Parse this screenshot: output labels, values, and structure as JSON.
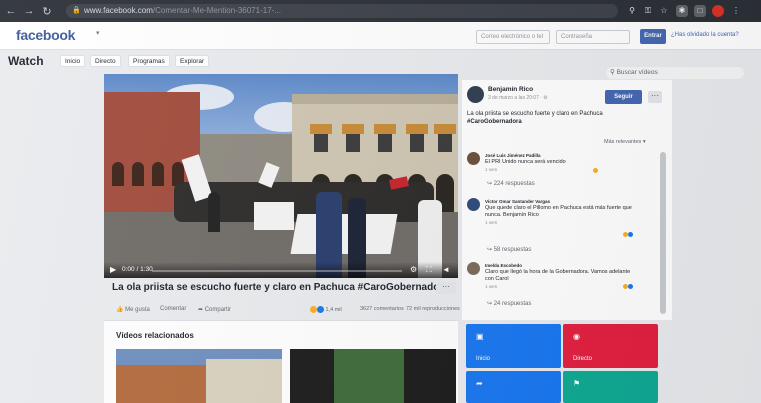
{
  "browser": {
    "url_domain": "www.facebook.com",
    "url_path": "/Comentar-Me-Mention-36071-17-...",
    "back_icon": "arrow-left-icon",
    "forward_icon": "arrow-right-icon",
    "reload_icon": "reload-icon"
  },
  "header": {
    "logo": "facebook",
    "email_placeholder": "Correo electrónico o tel",
    "password_placeholder": "Contraseña",
    "login_label": "Entrar",
    "forgot_label": "¿Has olvidado la cuenta?"
  },
  "watch": {
    "title": "Watch",
    "tabs": [
      "Inicio",
      "Directo",
      "Programas",
      "Explorar"
    ],
    "search_placeholder": "Buscar vídeos"
  },
  "video": {
    "time": "0:00 / 1:30",
    "title": "La ola priista se escucho fuerte y claro en Pachuca #CaroGobernadora",
    "more": "···",
    "actions": {
      "like": "Me gusta",
      "comment": "Comentar",
      "share": "Compartir"
    },
    "stats": {
      "reactions": "1,4 mil",
      "comments": "3627 comentarios",
      "views": "72 mil reproducciones"
    }
  },
  "related": {
    "title": "Vídeos relacionados"
  },
  "post": {
    "author": "Benjamín Rico",
    "meta": "3 de marzo a las 20:07 · ⚙",
    "follow_label": "Seguir",
    "more": "···",
    "text": "La ola priista se escucho fuerte y claro en Pachuca",
    "hashtag": "#CaroGobernadora",
    "sort_label": "Más relevantes ▾"
  },
  "comments": [
    {
      "name": "José Luis Jiménez Padilla",
      "text": "El PRI Unido nunca será vencido",
      "time": "1 sem",
      "reactions": "",
      "replies": "↪ 224 respuestas"
    },
    {
      "name": "Víctor Omar Santander Vargas",
      "text": "Que quede claro el Pillomo en Pachuca está más fuerte que nunca. Benjamín Rico",
      "time": "1 sem",
      "reactions": "",
      "replies": "↪ 58 respuestas"
    },
    {
      "name": "Imelda Escobedo",
      "text": "Claro que llegó la hora de la Gobernadora. Vamos adelante con Carol",
      "time": "1 sem",
      "reactions": "",
      "replies": "↪ 24 respuestas"
    }
  ],
  "tiles": [
    {
      "label": "Inicio",
      "icon": "tv-icon",
      "color": "#1877f2"
    },
    {
      "label": "Directo",
      "icon": "live-icon",
      "color": "#e41e3f"
    },
    {
      "label": "",
      "icon": "share-icon",
      "color": "#1877f2"
    },
    {
      "label": "",
      "icon": "bookmark-icon",
      "color": "#0ea993"
    }
  ]
}
